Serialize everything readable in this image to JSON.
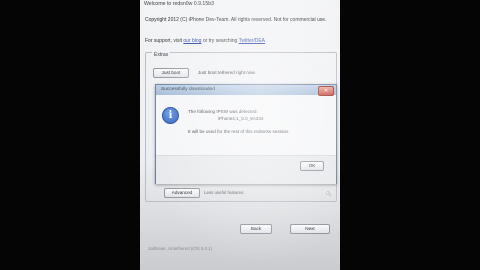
{
  "window": {
    "title": "Welcome to redsn0w 0.9.15b3",
    "copyright": "Copyright 2012 (C) iPhone Dev-Team. All rights reserved. Not for commercial use.",
    "support_prefix": "For support, visit",
    "support_link1": "our blog",
    "support_middle": "or try searching",
    "support_link2": "Twitter/DEA"
  },
  "extras": {
    "group_label": "Extras",
    "just_boot_label": "Just boot",
    "just_boot_desc": "Just boot tethered right now.",
    "advanced_label": "Advanced",
    "advanced_desc": "Less useful features."
  },
  "dialog": {
    "title": "Successfully downloaded",
    "message_line1": "The following IPSW was detected:",
    "message_line2": "iPhone4,1_5.0_9A334",
    "message_line3": "It will be used for the rest of this redsn0w session.",
    "ok_label": "OK",
    "close_glyph": "✕",
    "icon": "info-icon",
    "icon_glyph": "i"
  },
  "footer": {
    "back_label": "Back",
    "next_label": "Next",
    "status_text": "Jailbreak, Untethered (iOS 5.0.1)"
  },
  "cursor_glyph": "↖",
  "colors": {
    "titlebar": "#a9c0dd",
    "close_button": "#c8473a",
    "info_icon": "#1d4fb2",
    "link": "#1f3fa8"
  }
}
